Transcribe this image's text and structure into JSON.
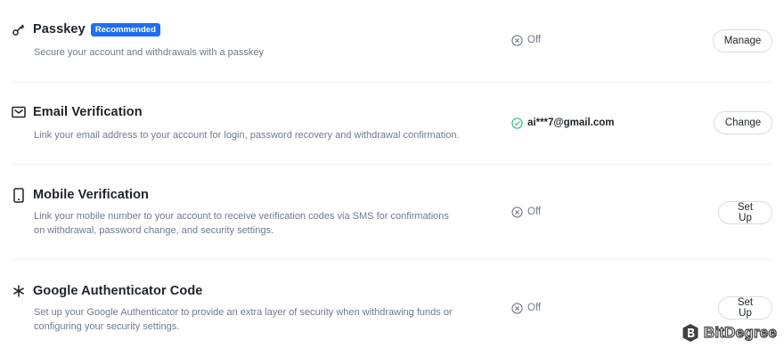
{
  "security_methods": [
    {
      "title": "Passkey",
      "badge": "Recommended",
      "description": "Secure your account and withdrawals with a passkey",
      "status": "Off",
      "button": "Manage",
      "icon": "key-icon"
    },
    {
      "title": "Email Verification",
      "description": "Link your email address to your account for login, password recovery and withdrawal confirmation.",
      "status": "ai***7@gmail.com",
      "button": "Change",
      "icon": "email-icon"
    },
    {
      "title": "Mobile Verification",
      "description_lines": [
        "Link your mobile number to your account to receive verification codes via SMS for confirmations",
        "on withdrawal, password change, and security settings."
      ],
      "status": "Off",
      "button": "Set Up",
      "icon": "phone-icon"
    },
    {
      "title": "Google Authenticator Code",
      "description_lines": [
        "Set up your Google Authenticator to provide an extra layer of security when withdrawing funds or",
        "configuring your security settings."
      ],
      "status": "Off",
      "button": "Set Up",
      "icon": "authenticator-icon"
    }
  ],
  "watermark": {
    "text": "BitDegree"
  },
  "colors": {
    "badge_bg": "#1f6df2",
    "status_on": "#2ebd85",
    "status_off": "#707a8a",
    "text_primary": "#1e2329"
  }
}
